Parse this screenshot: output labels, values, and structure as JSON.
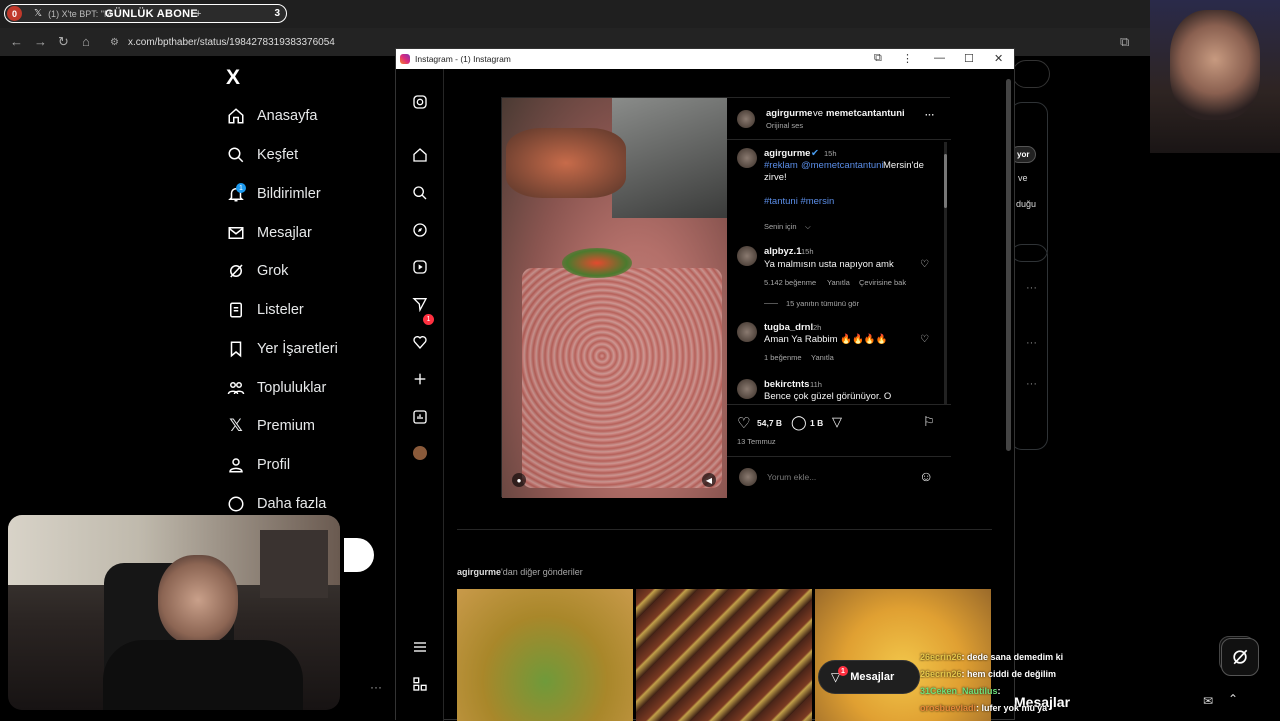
{
  "browser": {
    "tab_badge": "0",
    "tab_title": "(1) X'te BPT: \"M",
    "tab_banner": "GÜNLÜK ABONE",
    "tab_plus": "+",
    "tab_count": "3",
    "url": "x.com/bpthaber/status/1984278319383376054"
  },
  "x_sidebar": {
    "logo": "X",
    "notif_badge": "1",
    "items": [
      {
        "label": "Anasayfa",
        "icon": "home-icon"
      },
      {
        "label": "Keşfet",
        "icon": "search-icon"
      },
      {
        "label": "Bildirimler",
        "icon": "bell-icon"
      },
      {
        "label": "Mesajlar",
        "icon": "mail-icon"
      },
      {
        "label": "Grok",
        "icon": "grok-icon"
      },
      {
        "label": "Listeler",
        "icon": "list-icon"
      },
      {
        "label": "Yer İşaretleri",
        "icon": "bookmark-icon"
      },
      {
        "label": "Topluluklar",
        "icon": "community-icon"
      },
      {
        "label": "Premium",
        "icon": "x-premium-icon"
      },
      {
        "label": "Profil",
        "icon": "profile-icon"
      },
      {
        "label": "Daha fazla",
        "icon": "more-icon"
      }
    ]
  },
  "x_right": {
    "snippet1": "yor",
    "snippet2": "ve",
    "snippet3": "duğu",
    "mesajlar": "Mesajlar"
  },
  "ig_window": {
    "title": "Instagram - (1) Instagram",
    "sidebar_badge": "1",
    "post": {
      "header_user1": "agirgurme",
      "header_and": "ve",
      "header_user2": "memetcantantuni",
      "header_sub": "Orijinal ses",
      "author": "agirgurme",
      "author_time": "15h",
      "caption_tag1": "#reklam",
      "caption_mention": "@memetcantantuni",
      "caption_text": "Mersin'de",
      "caption_text2": "zirve!",
      "caption_hashtags": "#tantuni #mersin",
      "sort_label": "Senin için",
      "comments": [
        {
          "user": "alpbyz.1",
          "time": "15h",
          "text": "Ya malmısın usta napıyon amk",
          "likes": "5.142 beğenme",
          "reply": "Yanıtla",
          "translate": "Çevirisine bak",
          "view_replies": "15 yanıtın tümünü gör"
        },
        {
          "user": "tugba_drnl",
          "time": "2h",
          "text": "Aman Ya Rabbim 🔥🔥🔥🔥",
          "likes": "1 beğenme",
          "reply": "Yanıtla"
        },
        {
          "user": "bekirctnts",
          "time": "11h",
          "text": "Bence çok güzel görünüyor. O"
        }
      ],
      "like_count": "54,7 B",
      "comment_count": "1 B",
      "date": "13 Temmuz",
      "comment_placeholder": "Yorum ekle..."
    },
    "more_posts_user": "agirgurme",
    "more_posts_suffix": "'dan diğer gönderiler"
  },
  "messages_button": {
    "label": "Mesajlar",
    "badge": "1"
  },
  "chat": [
    {
      "user": "26ecrin26",
      "text": ": dede sana demedim ki"
    },
    {
      "user": "26ecrin26",
      "text": ": hem ciddi de değilim"
    },
    {
      "user": "31Ceken_Nautilus",
      "text": ":"
    },
    {
      "user": "orosbuevladi",
      "text": ": lufer yok mu'ya"
    }
  ]
}
